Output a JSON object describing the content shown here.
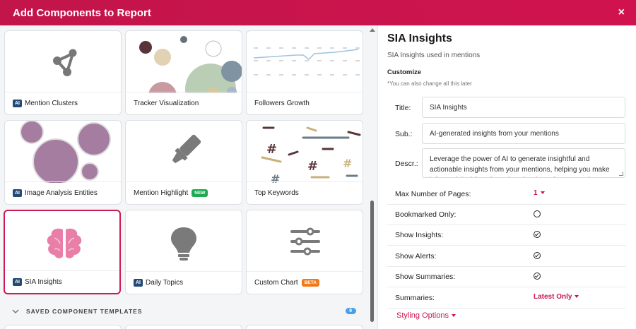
{
  "header": {
    "title": "Add Components to Report",
    "close_label": "×"
  },
  "components": [
    {
      "label": "Mention Clusters",
      "ai": true,
      "icon": "cluster-icon"
    },
    {
      "label": "Tracker Visualization",
      "ai": false,
      "icon": "bubble-chart-icon"
    },
    {
      "label": "Followers Growth",
      "ai": false,
      "icon": "line-chart-icon"
    },
    {
      "label": "Image Analysis Entities",
      "ai": true,
      "icon": "bubble-image-icon"
    },
    {
      "label": "Mention Highlight",
      "ai": false,
      "badge": "NEW",
      "icon": "highlighter-icon"
    },
    {
      "label": "Top Keywords",
      "ai": false,
      "icon": "keywords-icon"
    },
    {
      "label": "SIA Insights",
      "ai": true,
      "selected": true,
      "icon": "brain-icon"
    },
    {
      "label": "Daily Topics",
      "ai": true,
      "icon": "lightbulb-icon"
    },
    {
      "label": "Custom Chart",
      "ai": false,
      "badge": "BETA",
      "icon": "sliders-icon"
    }
  ],
  "ai_badge": "AI",
  "saved_templates": {
    "label": "SAVED COMPONENT TEMPLATES",
    "count": "9"
  },
  "panel": {
    "title": "SIA Insights",
    "subtitle": "SIA Insights used in mentions",
    "customize": "Customize",
    "note": "*You can also change all this later",
    "title_label": "Title:",
    "title_value": "SIA Insights",
    "sub_label": "Sub.:",
    "sub_value": "AI-generated insights from your mentions",
    "descr_label": "Descr.:",
    "descr_value": "Leverage the power of AI to generate insightful and actionable insights from your mentions, helping you make informed decisions based on the data of your mentions.",
    "options": [
      {
        "label": "Max Number of Pages:",
        "type": "dropdown",
        "value": "1"
      },
      {
        "label": "Bookmarked Only:",
        "type": "radio",
        "checked": false
      },
      {
        "label": "Show Insights:",
        "type": "check",
        "checked": true
      },
      {
        "label": "Show Alerts:",
        "type": "check",
        "checked": true
      },
      {
        "label": "Show Summaries:",
        "type": "check",
        "checked": true
      },
      {
        "label": "Summaries:",
        "type": "dropdown",
        "value": "Latest Only"
      }
    ],
    "styling_label": "Styling Options"
  },
  "colors": {
    "accent": "#c8174e",
    "header": "#c2154a",
    "ai_badge": "#234a75",
    "new_badge": "#1faa53",
    "beta_badge": "#f07a1a"
  }
}
